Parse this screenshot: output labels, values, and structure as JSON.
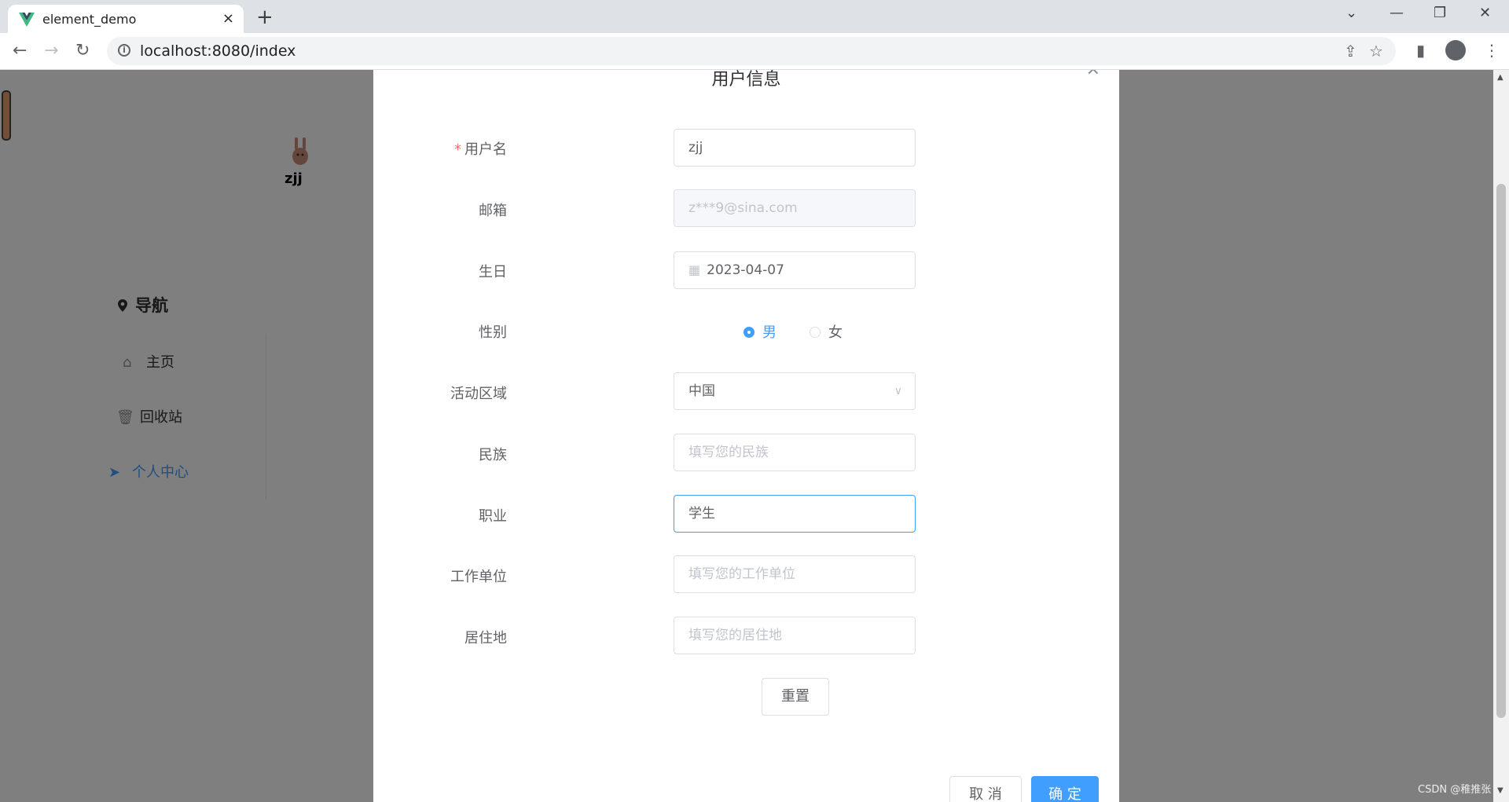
{
  "browser": {
    "tab_title": "element_demo",
    "url": "localhost:8080/index",
    "new_tab": "+",
    "tab_close": "×"
  },
  "sidebar": {
    "username": "zjj",
    "nav_title": "导航",
    "items": [
      {
        "label": "主页",
        "icon": "home-icon"
      },
      {
        "label": "回收站",
        "icon": "trash-icon"
      },
      {
        "label": "个人中心",
        "icon": "paper-plane-icon",
        "active": true
      }
    ]
  },
  "dialog": {
    "title": "用户信息",
    "fields": {
      "username": {
        "label": "用户名",
        "value": "zjj",
        "required": "*"
      },
      "email": {
        "label": "邮箱",
        "value": "z***9@sina.com"
      },
      "birthday": {
        "label": "生日",
        "value": "2023-04-07"
      },
      "gender": {
        "label": "性别",
        "options": [
          "男",
          "女"
        ],
        "selected": "男"
      },
      "region": {
        "label": "活动区域",
        "value": "中国"
      },
      "ethnicity": {
        "label": "民族",
        "placeholder": "填写您的民族"
      },
      "occupation": {
        "label": "职业",
        "value": "学生"
      },
      "employer": {
        "label": "工作单位",
        "placeholder": "填写您的工作单位"
      },
      "residence": {
        "label": "居住地",
        "placeholder": "填写您的居住地"
      }
    },
    "reset_label": "重置",
    "cancel_label": "取 消",
    "confirm_label": "确 定"
  },
  "watermark": "CSDN @稚推张",
  "colors": {
    "primary": "#409eff",
    "required": "#f56c6c",
    "overlay": "rgba(0,0,0,0.5)"
  }
}
